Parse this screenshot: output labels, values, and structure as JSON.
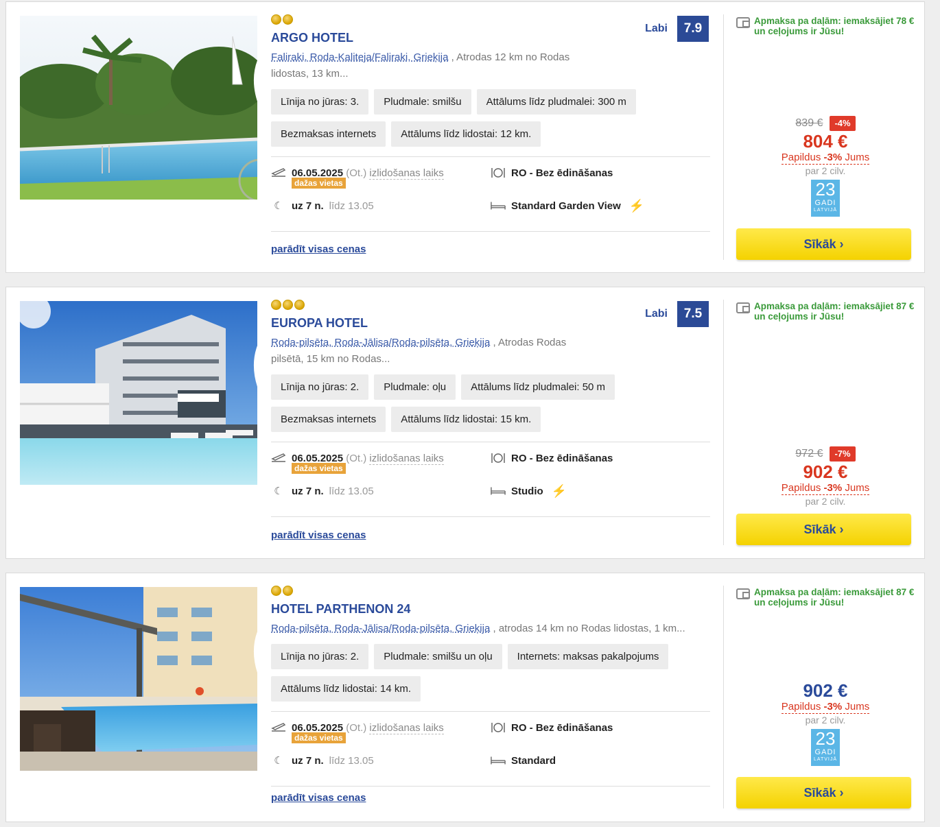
{
  "colors": {
    "accent": "#2a4a9a",
    "price_red": "#d9361f",
    "button_yellow": "#f4d200",
    "few_seats": "#e8a33a",
    "install_green": "#3a9a3a"
  },
  "hotels": [
    {
      "name": "ARGO HOTEL",
      "stars": 2,
      "rating_label": "Labi",
      "rating_score": "7.9",
      "location_link": "Faliraki, Roda-Kaliteja/Faliraki, Grieķija",
      "location_text": ", Atrodas 12 km no Rodas lidostas, 13 km...",
      "tags": [
        "Līnija no jūras: 3.",
        "Pludmale: smilšu",
        "Attālums līdz pludmalei: 300 m",
        "Bezmaksas internets",
        "Attālums līdz lidostai: 12 km."
      ],
      "date": "06.05.2025",
      "weekday": "(Ot.)",
      "departure_label": "izlidošanas laiks",
      "few_seats": "dažas vietas",
      "nights": "uz 7 n.",
      "until": "līdz 13.05",
      "board": "RO - Bez ēdināšanas",
      "room": "Standard Garden View",
      "room_bolt": true,
      "prices_link": "parādīt visas cenas",
      "installment": "Apmaksa pa daļām: iemaksājiet 78 € un ceļojums ir Jūsu!",
      "old_price": "839 €",
      "discount": "-4%",
      "price": "804 €",
      "extra_prefix": "Papildus",
      "extra_pct": "-3%",
      "extra_suffix": "Jums",
      "per": "par 2 cilv.",
      "badge": {
        "number": "23",
        "word": "GADI",
        "country": "LATVIJĀ"
      },
      "more_label": "Sīkāk ›"
    },
    {
      "name": "EUROPA HOTEL",
      "stars": 3,
      "rating_label": "Labi",
      "rating_score": "7.5",
      "location_link": "Roda-pilsēta, Roda-Jālisa/Roda-pilsēta, Grieķija",
      "location_text": ", Atrodas Rodas pilsētā, 15 km no Rodas...",
      "tags": [
        "Līnija no jūras: 2.",
        "Pludmale: oļu",
        "Attālums līdz pludmalei: 50 m",
        "Bezmaksas internets",
        "Attālums līdz lidostai: 15 km."
      ],
      "date": "06.05.2025",
      "weekday": "(Ot.)",
      "departure_label": "izlidošanas laiks",
      "few_seats": "dažas vietas",
      "nights": "uz 7 n.",
      "until": "līdz 13.05",
      "board": "RO - Bez ēdināšanas",
      "room": "Studio",
      "room_bolt": true,
      "prices_link": "parādīt visas cenas",
      "installment": "Apmaksa pa daļām: iemaksājiet 87 € un ceļojums ir Jūsu!",
      "old_price": "972 €",
      "discount": "-7%",
      "price": "902 €",
      "extra_prefix": "Papildus",
      "extra_pct": "-3%",
      "extra_suffix": "Jums",
      "per": "par 2 cilv.",
      "more_label": "Sīkāk ›"
    },
    {
      "name": "HOTEL PARTHENON 24",
      "stars": 2,
      "location_link": "Roda-pilsēta, Roda-Jālisa/Roda-pilsēta, Grieķija",
      "location_text": ", atrodas 14 km no Rodas lidostas, 1 km...",
      "tags": [
        "Līnija no jūras: 2.",
        "Pludmale: smilšu un oļu",
        "Internets: maksas pakalpojums",
        "Attālums līdz lidostai: 14 km."
      ],
      "date": "06.05.2025",
      "weekday": "(Ot.)",
      "departure_label": "izlidošanas laiks",
      "few_seats": "dažas vietas",
      "nights": "uz 7 n.",
      "until": "līdz 13.05",
      "board": "RO - Bez ēdināšanas",
      "room": "Standard",
      "room_bolt": false,
      "prices_link": "parādīt visas cenas",
      "installment": "Apmaksa pa daļām: iemaksājiet 87 € un ceļojums ir Jūsu!",
      "price": "902 €",
      "extra_prefix": "Papildus",
      "extra_pct": "-3%",
      "extra_suffix": "Jums",
      "per": "par 2 cilv.",
      "badge": {
        "number": "23",
        "word": "GADI",
        "country": "LATVIJĀ"
      },
      "more_label": "Sīkāk ›"
    }
  ]
}
